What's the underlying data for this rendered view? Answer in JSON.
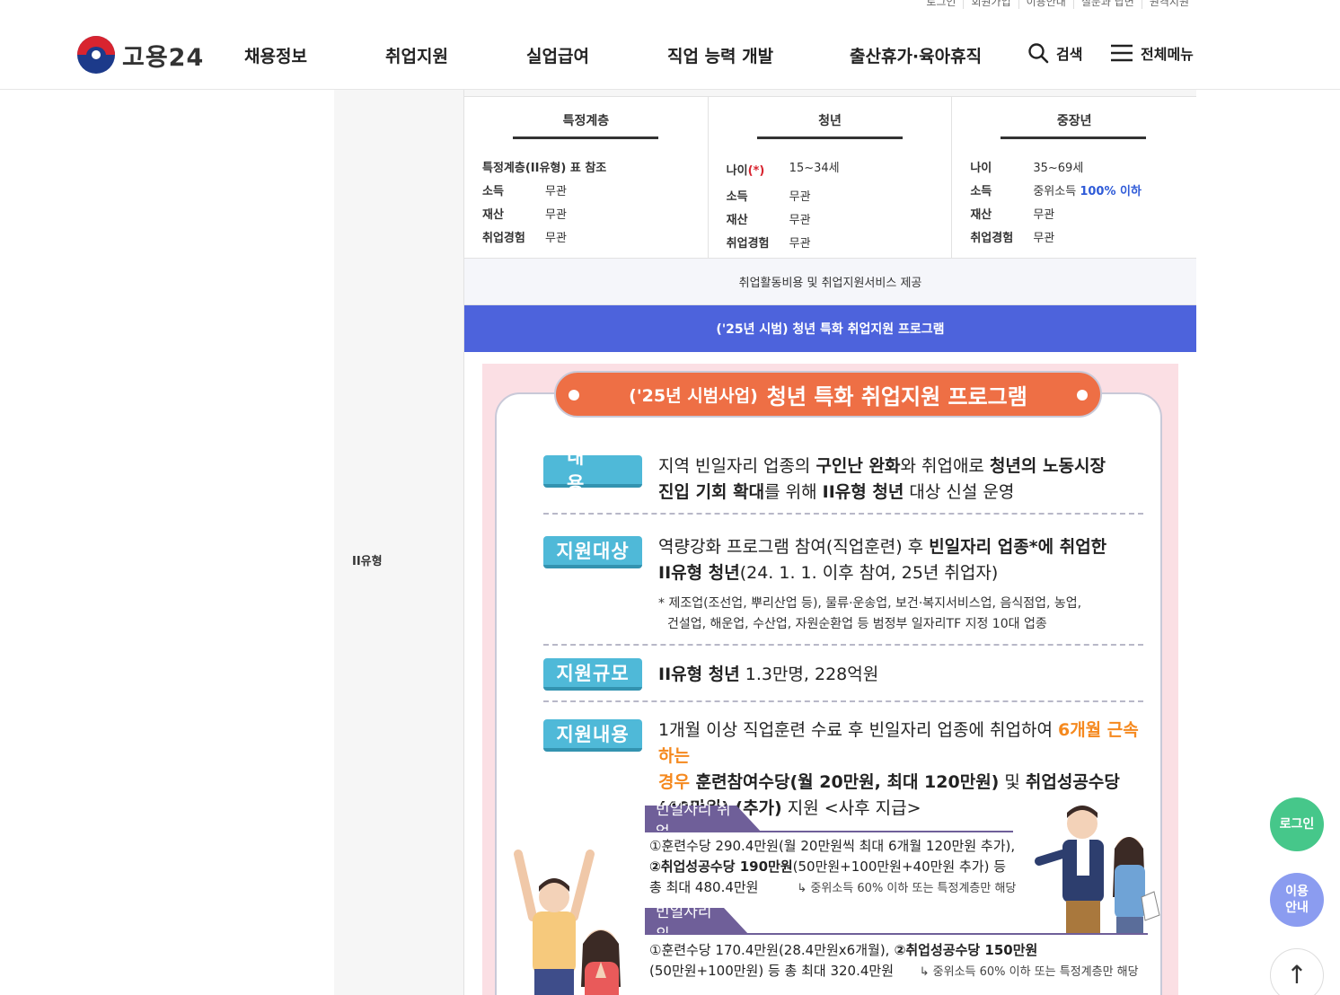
{
  "util_links": [
    "로그인",
    "회원가입",
    "이용안내",
    "질문과 답변",
    "원격지원"
  ],
  "brand": {
    "logo_text": "고용24"
  },
  "nav": [
    "채용정보",
    "취업지원",
    "실업급여",
    "직업 능력 개발",
    "출산휴가·육아휴직"
  ],
  "header_actions": {
    "search_label": "검색",
    "menu_label": "전체메뉴"
  },
  "row_label": "II유형",
  "groups": [
    {
      "title": "특정계층",
      "rows": [
        {
          "full": "특정계층(II유형) 표 참조"
        },
        {
          "k": "소득",
          "v": "무관"
        },
        {
          "k": "재산",
          "v": "무관"
        },
        {
          "k": "취업경험",
          "v": "무관"
        }
      ]
    },
    {
      "title": "청년",
      "rows": [
        {
          "k": "나이",
          "star": "(*)",
          "v": "15~34세"
        },
        {
          "k": "소득",
          "v": "무관"
        },
        {
          "k": "재산",
          "v": "무관"
        },
        {
          "k": "취업경험",
          "v": "무관"
        }
      ]
    },
    {
      "title": "중장년",
      "rows": [
        {
          "k": "나이",
          "v": "35~69세"
        },
        {
          "k": "소득",
          "v": "중위소득",
          "v_hl": "100% 이하"
        },
        {
          "k": "재산",
          "v": "무관"
        },
        {
          "k": "취업경험",
          "v": "무관"
        }
      ]
    }
  ],
  "service_row": "취업활동비용 및 취업지원서비스 제공",
  "blue_bar": "('25년 시범) 청년 특화 취업지원 프로그램",
  "poster": {
    "title_small": "('25년 시범사업)",
    "title_big": "청년 특화 취업지원 프로그램",
    "sections": {
      "content": {
        "tag": "내용",
        "l1a": "지역 빈일자리 업종의 ",
        "l1b": "구인난 완화",
        "l1c": "와 취업애로 ",
        "l1d": "청년의 노동시장",
        "l2a": "진입 기회 확대",
        "l2b": "를 위해 ",
        "l2c": "II유형 청년",
        "l2d": " 대상 신설 운영"
      },
      "target": {
        "tag": "지원대상",
        "l1a": "역량강화 프로그램 참여(직업훈련) 후 ",
        "l1b": "빈일자리 업종*에 취업한",
        "l2a": "II유형 청년",
        "l2b": "(24. 1. 1. 이후 참여, 25년 취업자)",
        "n1": "* 제조업(조선업, 뿌리산업 등), 물류·운송업, 보건·복지서비스업, 음식점업, 농업,",
        "n2": "건설업, 해운업, 수산업, 자원순환업 등 범정부 일자리TF 지정 10대 업종"
      },
      "scale": {
        "tag": "지원규모",
        "a": "II유형 청년",
        "b": " 1.3만명, 228억원"
      },
      "support": {
        "tag": "지원내용",
        "l1a": "1개월 이상 직업훈련 수료 후 빈일자리 업종에 취업하여 ",
        "l1b": "6개월 근속하는",
        "l2a": "경우",
        "l2b": " 훈련참여수당(월 20만원, 최대 120만원)",
        "l2c": " 및 ",
        "l2d": "취업성공수당",
        "l3a": "(40만원) (추가)",
        "l3b": " 지원 <사후 지급>"
      }
    },
    "vacant_job": {
      "label": "빈일자리 취업",
      "line1": "①훈련수당 290.4만원(월 20만원씩 최대 6개월 120만원 추가),",
      "line2a": "②취업성공수당 190만원",
      "line2b": "(50만원+100만원+40만원 추가) 등",
      "line3": "총 최대 480.4만원",
      "note": "↳ 중위소득 60% 이하 또는 특정계층만 해당"
    },
    "other_job": {
      "label": "빈일자리 외",
      "line1a": "①훈련수당 170.4만원(28.4만원x6개월),",
      "line1b": " ②취업성공수당 150만원",
      "line2": "(50만원+100만원) 등 총 최대 320.4만원",
      "note": "↳ 중위소득 60% 이하 또는 특정계층만 해당"
    }
  },
  "floating": {
    "login": "로그인",
    "guide1": "이용",
    "guide2": "안내",
    "top": "↑"
  },
  "colors": {
    "brand_blue": "#4d63dc",
    "tag_blue": "#4fb9d8",
    "title_orange": "#ee6f45",
    "sub_purple": "#6f5f99",
    "login_green": "#46c78a",
    "guide_purple": "#8b9cf0"
  }
}
